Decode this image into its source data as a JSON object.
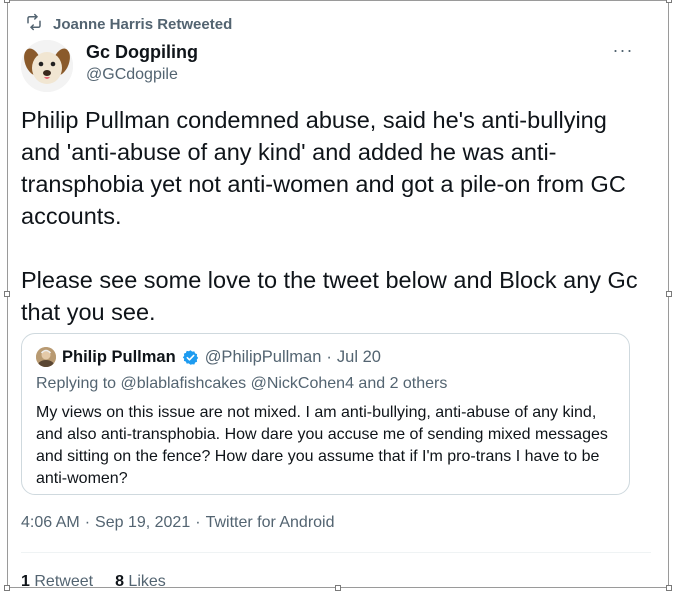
{
  "retweet_bar": {
    "icon": "retweet-icon",
    "label": "Joanne Harris Retweeted"
  },
  "tweet": {
    "author_name": "Gc Dogpiling",
    "author_handle": "@GCdogpile",
    "avatar": "dog-face-avatar",
    "more_icon": "more-options-icon",
    "more_label": "···",
    "text_para1": "Philip Pullman condemned abuse, said he's anti-bullying and 'anti-abuse of any kind' and added he was anti-transphobia yet not anti-women and got a pile-on from GC accounts.",
    "text_para2": "Please see some love to the tweet below and Block any Gc that you see.",
    "time": "4:06 AM",
    "date": "Sep 19, 2021",
    "client": "Twitter for Android",
    "separator": "·"
  },
  "quoted_tweet": {
    "author_name": "Philip Pullman",
    "verified_icon": "verified-badge-icon",
    "author_handle": "@PhilipPullman",
    "date": "Jul 20",
    "separator": "·",
    "replying_to": "Replying to @blablafishcakes @NickCohen4 and 2 others",
    "text": "My views on this issue are not mixed. I am anti-bullying, anti-abuse of any kind, and also anti-transphobia. How dare you accuse me of sending mixed messages and sitting on the fence? How dare you assume that if I'm pro-trans I have to be anti-women?"
  },
  "stats": {
    "retweets_count": "1",
    "retweets_label": "Retweet",
    "likes_count": "8",
    "likes_label": "Likes"
  },
  "colors": {
    "primary_text": "#0f1419",
    "secondary_text": "#536471",
    "border": "#cfd9de",
    "verified_blue": "#1d9bf0"
  }
}
